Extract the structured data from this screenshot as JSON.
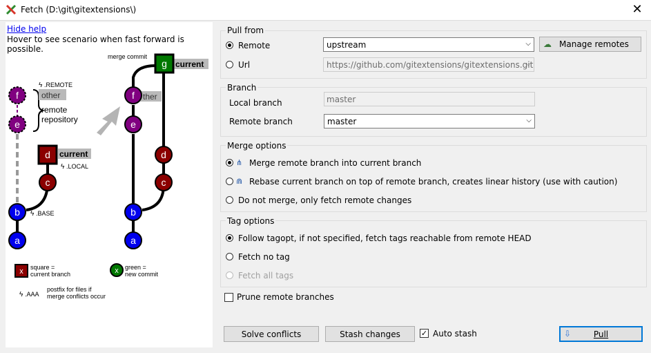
{
  "window": {
    "title": "Fetch (D:\\git\\gitextensions\\)",
    "close_glyph": "✕"
  },
  "help": {
    "hide_help": "Hide help",
    "hover_text": "Hover to see scenario when fast forward is possible.",
    "diagram": {
      "merge_commit": "merge commit",
      "remote_postfix": ".REMOTE",
      "other": "other",
      "other_partial": "ther",
      "remote_repository_line1": "remote",
      "remote_repository_line2": "repository",
      "current": "current",
      "local_postfix": ".LOCAL",
      "base_postfix": ".BASE",
      "nodes": {
        "f": "f",
        "e": "e",
        "d": "d",
        "c": "c",
        "b": "b",
        "a": "a",
        "g": "g",
        "x": "x"
      },
      "legend_square_line1": "square =",
      "legend_square_line2": "current branch",
      "legend_green_line1": "green =",
      "legend_green_line2": "new commit",
      "aaa_postfix": ".AAA",
      "aaa_text_line1": "postfix for files if",
      "aaa_text_line2": "merge conflicts occur"
    }
  },
  "pull_from": {
    "label": "Pull from",
    "remote_label": "Remote",
    "remote_value": "upstream",
    "url_label": "Url",
    "url_value": "https://github.com/gitextensions/gitextensions.git",
    "manage_remotes": "Manage remotes"
  },
  "branch": {
    "label": "Branch",
    "local_label": "Local branch",
    "local_value": "master",
    "remote_label": "Remote branch",
    "remote_value": "master"
  },
  "merge_options": {
    "label": "Merge options",
    "merge": "Merge remote branch into current branch",
    "rebase": "Rebase current branch on top of remote branch, creates linear history (use with caution)",
    "fetch_only": "Do not merge, only fetch remote changes"
  },
  "tag_options": {
    "label": "Tag options",
    "follow": "Follow tagopt, if not specified, fetch tags reachable from remote HEAD",
    "no_tag": "Fetch no tag",
    "all_tags": "Fetch all tags"
  },
  "prune": {
    "label": "Prune remote branches"
  },
  "footer": {
    "solve_conflicts": "Solve conflicts",
    "stash_changes": "Stash changes",
    "auto_stash": "Auto stash",
    "pull": "Pull"
  }
}
